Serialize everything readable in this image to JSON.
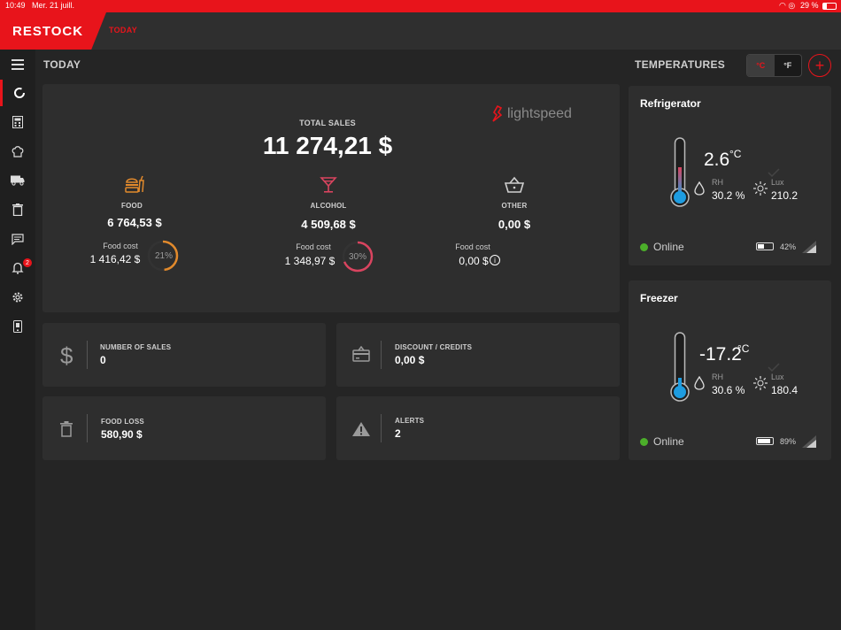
{
  "status_bar": {
    "time": "10:49",
    "date": "Mer. 21 juill.",
    "battery": "29 %"
  },
  "app": {
    "logo": "RESTOCK",
    "active_tab": "TODAY",
    "brand_color": "#e8141b"
  },
  "sidebar": {
    "items": [
      {
        "name": "menu-icon"
      },
      {
        "name": "today-icon",
        "active": true
      },
      {
        "name": "calculator-icon"
      },
      {
        "name": "chef-hat-icon"
      },
      {
        "name": "truck-icon"
      },
      {
        "name": "trash-icon"
      },
      {
        "name": "messages-icon"
      },
      {
        "name": "bell-icon",
        "badge": "2"
      },
      {
        "name": "gear-icon"
      },
      {
        "name": "device-icon"
      }
    ]
  },
  "main": {
    "title": "TODAY"
  },
  "sales": {
    "brand": "lightspeed",
    "total_label": "TOTAL SALES",
    "total_value": "11 274,21 $",
    "categories": [
      {
        "name": "FOOD",
        "value": "6 764,53 $",
        "cost_label": "Food cost",
        "cost_value": "1 416,42 $",
        "percent": "21%",
        "percent_value": 21,
        "color": "#e28a2c"
      },
      {
        "name": "ALCOHOL",
        "value": "4 509,68 $",
        "cost_label": "Food cost",
        "cost_value": "1 348,97 $",
        "percent": "30%",
        "percent_value": 30,
        "color": "#d9445f"
      },
      {
        "name": "OTHER",
        "value": "0,00 $",
        "cost_label": "Food cost",
        "cost_value": "0,00 $"
      }
    ]
  },
  "stats": [
    {
      "label": "NUMBER OF SALES",
      "value": "0"
    },
    {
      "label": "DISCOUNT / CREDITS",
      "value": "0,00 $"
    },
    {
      "label": "FOOD LOSS",
      "value": "580,90 $"
    },
    {
      "label": "ALERTS",
      "value": "2"
    }
  ],
  "temperatures": {
    "title": "TEMPERATURES",
    "unit_c": "°C",
    "unit_f": "°F",
    "selected_unit": "°C",
    "sensors": [
      {
        "name": "Refrigerator",
        "temp": "2.6",
        "unit": "°C",
        "rh_label": "RH",
        "rh": "30.2 %",
        "lux_label": "Lux",
        "lux": "210.2",
        "status": "Online",
        "battery": "42%",
        "battery_level": 0.42,
        "status_color": "#4caf2a"
      },
      {
        "name": "Freezer",
        "temp": "-17.2",
        "unit": "°C",
        "rh_label": "RH",
        "rh": "30.6 %",
        "lux_label": "Lux",
        "lux": "180.4",
        "status": "Online",
        "battery": "89%",
        "battery_level": 0.89,
        "status_color": "#4caf2a"
      }
    ]
  }
}
